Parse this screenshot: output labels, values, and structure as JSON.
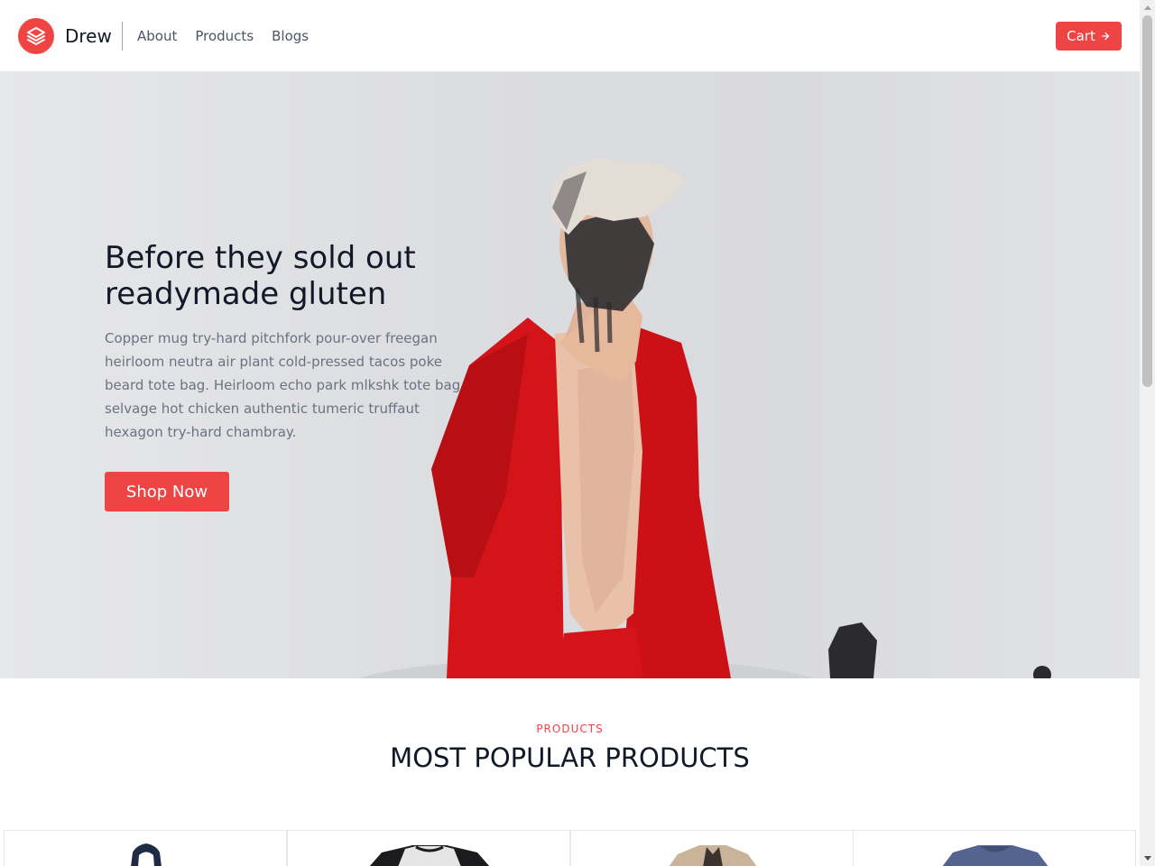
{
  "header": {
    "logo_icon": "layers-icon",
    "brand": "Drew",
    "nav": [
      {
        "label": "About"
      },
      {
        "label": "Products"
      },
      {
        "label": "Blogs"
      }
    ],
    "cart_label": "Cart",
    "cart_icon": "arrow-right-icon"
  },
  "hero": {
    "title": "Before they sold out readymade gluten",
    "text": "Copper mug try-hard pitchfork pour-over freegan heirloom neutra air plant cold-pressed tacos poke beard tote bag. Heirloom echo park mlkshk tote bag selvage hot chicken authentic tumeric truffaut hexagon try-hard chambray.",
    "button_label": "Shop Now"
  },
  "products": {
    "eyebrow": "PRODUCTS",
    "heading": "MOST POPULAR PRODUCTS",
    "cards": [
      {
        "image": "hoodie-navy-image"
      },
      {
        "image": "raglan-tee-black-white-image"
      },
      {
        "image": "jacket-tan-image"
      },
      {
        "image": "tee-blue-image"
      }
    ]
  },
  "colors": {
    "accent": "#ef4444",
    "text_primary": "#111827",
    "text_muted": "#6b7280"
  }
}
